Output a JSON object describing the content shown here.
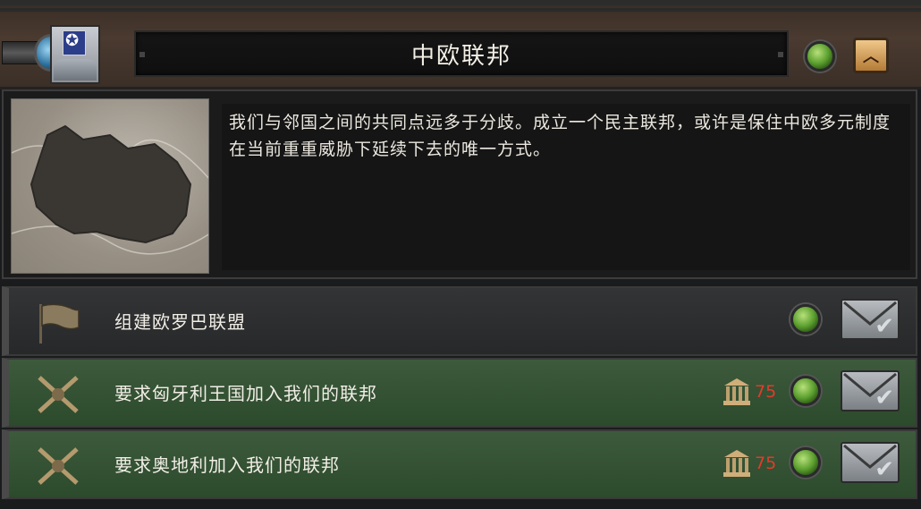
{
  "header": {
    "title": "中欧联邦",
    "emblem_icon": "federation-flag-icon",
    "collapse_icon": "chevron-up-icon"
  },
  "description": {
    "text": "我们与邻国之间的共同点远多于分歧。成立一个民主联邦，或许是保住中欧多元制度在当前重重威胁下延续下去的唯一方式。"
  },
  "decisions": [
    {
      "label": "组建欧罗巴联盟",
      "icon": "flag-icon",
      "cost": "",
      "style": "neutral"
    },
    {
      "label": "要求匈牙利王国加入我们的联邦",
      "icon": "crossed-rifles-icon",
      "cost": "75",
      "style": "green"
    },
    {
      "label": "要求奥地利加入我们的联邦",
      "icon": "crossed-rifles-icon",
      "cost": "75",
      "style": "green"
    }
  ],
  "colors": {
    "status_green": "#5a9e2e",
    "cost_red": "#e23b2b",
    "row_green": "#3d5a3c",
    "accent_gold": "#d6a55a"
  }
}
